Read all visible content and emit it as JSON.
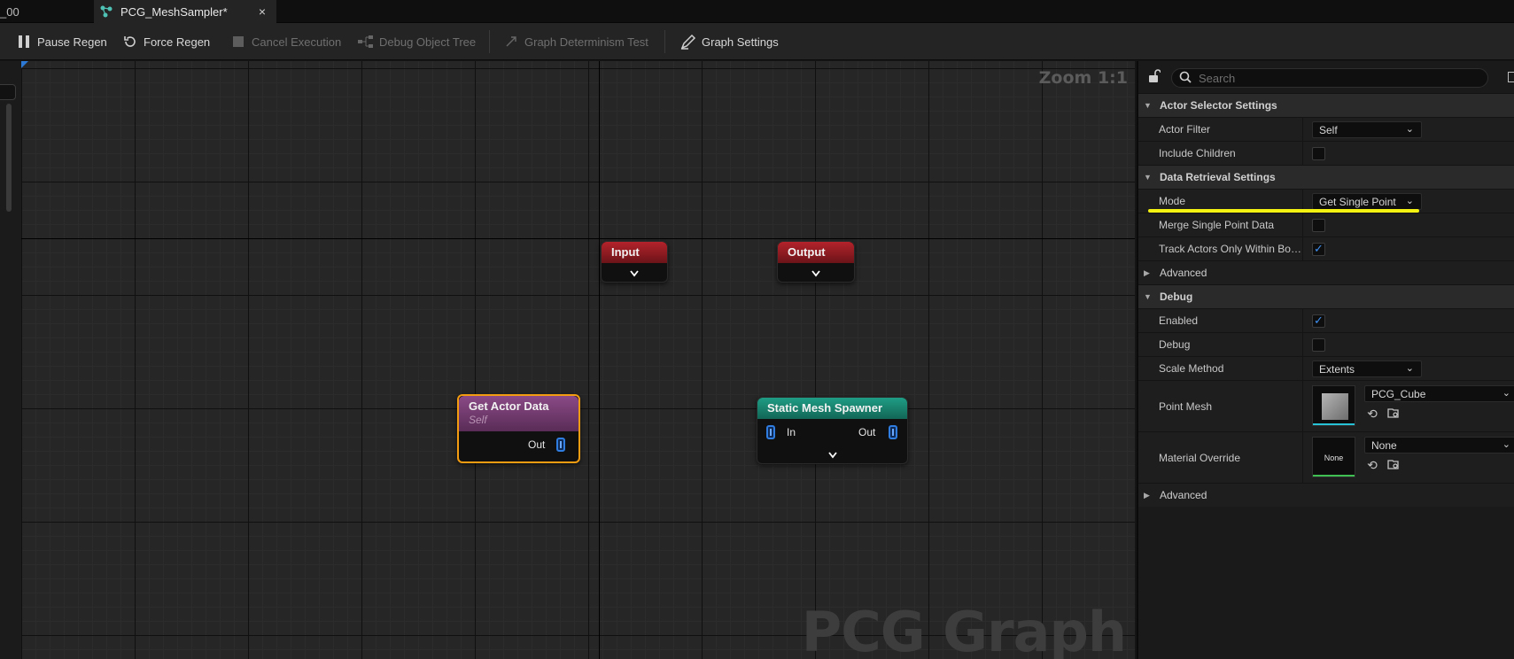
{
  "tabs": [
    {
      "label": "_00",
      "active": false
    },
    {
      "label": "PCG_MeshSampler*",
      "active": true,
      "close_glyph": "×"
    }
  ],
  "toolbar": {
    "pause_regen": "Pause Regen",
    "force_regen": "Force Regen",
    "cancel_execution": "Cancel Execution",
    "debug_object_tree": "Debug Object Tree",
    "graph_determinism_test": "Graph Determinism Test",
    "graph_settings": "Graph Settings"
  },
  "graph": {
    "zoom_label": "Zoom 1:1",
    "watermark": "PCG Graph",
    "nodes": {
      "input": {
        "title": "Input"
      },
      "output": {
        "title": "Output"
      },
      "get_actor_data": {
        "title": "Get Actor Data",
        "subtitle": "Self",
        "out_pin": "Out"
      },
      "static_mesh_spawner": {
        "title": "Static Mesh Spawner",
        "in_pin": "In",
        "out_pin": "Out"
      }
    }
  },
  "details": {
    "search_placeholder": "Search",
    "categories": {
      "actor_selector": "Actor Selector Settings",
      "data_retrieval": "Data Retrieval Settings",
      "debug": "Debug"
    },
    "properties": {
      "actor_filter": {
        "label": "Actor Filter",
        "value": "Self"
      },
      "include_children": {
        "label": "Include Children",
        "checked": false
      },
      "mode": {
        "label": "Mode",
        "value": "Get Single Point"
      },
      "merge_single_point": {
        "label": "Merge Single Point Data",
        "checked": false
      },
      "track_actors": {
        "label": "Track Actors Only Within Bou...",
        "checked": true
      },
      "advanced_1": {
        "label": "Advanced"
      },
      "enabled": {
        "label": "Enabled",
        "checked": true
      },
      "debug": {
        "label": "Debug",
        "checked": false
      },
      "scale_method": {
        "label": "Scale Method",
        "value": "Extents"
      },
      "point_mesh": {
        "label": "Point Mesh",
        "value": "PCG_Cube"
      },
      "material_override": {
        "label": "Material Override",
        "value": "None",
        "thumb_text": "None"
      },
      "advanced_2": {
        "label": "Advanced"
      }
    }
  },
  "colors": {
    "accent": "#2d7ad6",
    "selection": "#f39c12",
    "highlight": "#f4f210",
    "input_output_node": "#b3232b",
    "actor_node": "#8a4a86",
    "spawner_node": "#1f9d85"
  }
}
